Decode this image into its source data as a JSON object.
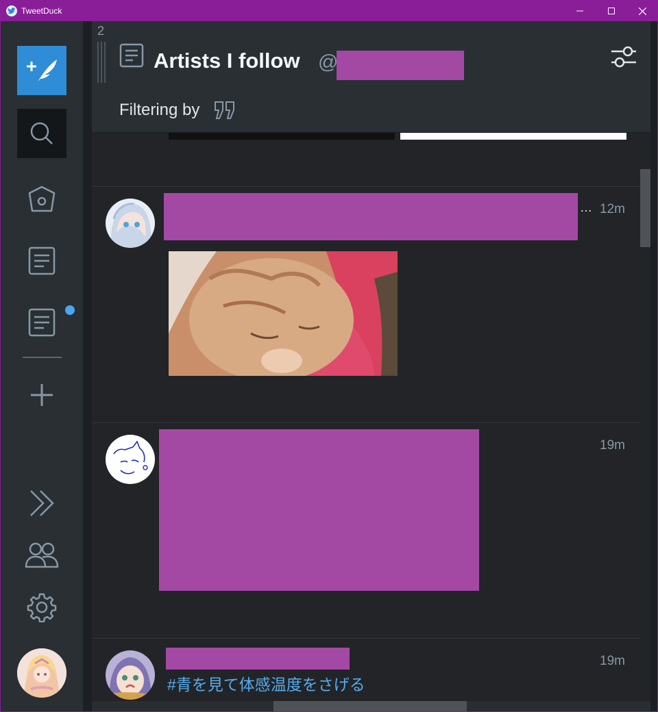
{
  "window": {
    "title": "TweetDuck",
    "controls": [
      "minimize",
      "maximize",
      "close"
    ]
  },
  "sidebar": {
    "items": [
      {
        "name": "compose",
        "icon": "compose-feather-icon"
      },
      {
        "name": "search",
        "icon": "search-icon"
      },
      {
        "name": "home",
        "icon": "home-icon"
      },
      {
        "name": "list-1",
        "icon": "list-icon"
      },
      {
        "name": "list-2",
        "icon": "list-icon",
        "unread": true
      },
      {
        "name": "add-column",
        "icon": "plus-icon"
      },
      {
        "name": "expand",
        "icon": "chevron-double-right-icon"
      },
      {
        "name": "accounts",
        "icon": "accounts-icon"
      },
      {
        "name": "settings",
        "icon": "gear-icon"
      },
      {
        "name": "profile",
        "icon": "avatar"
      }
    ],
    "accent": "#2f8cd6",
    "unread_dot_color": "#4aa6f0"
  },
  "column": {
    "number": "2",
    "title": "Artists I follow",
    "account_prefix": "@",
    "filter_label": "Filtering by",
    "tweets": [
      {
        "time": "12m",
        "has_media": true
      },
      {
        "time": "19m",
        "has_media": false
      },
      {
        "time": "19m",
        "hashtag": "#青を見て体感温度をさげる"
      }
    ]
  },
  "colors": {
    "background": "#222427",
    "header": "#292f33",
    "redaction": "#a349a4",
    "title_bar": "#8a1d98",
    "link": "#55acee"
  }
}
